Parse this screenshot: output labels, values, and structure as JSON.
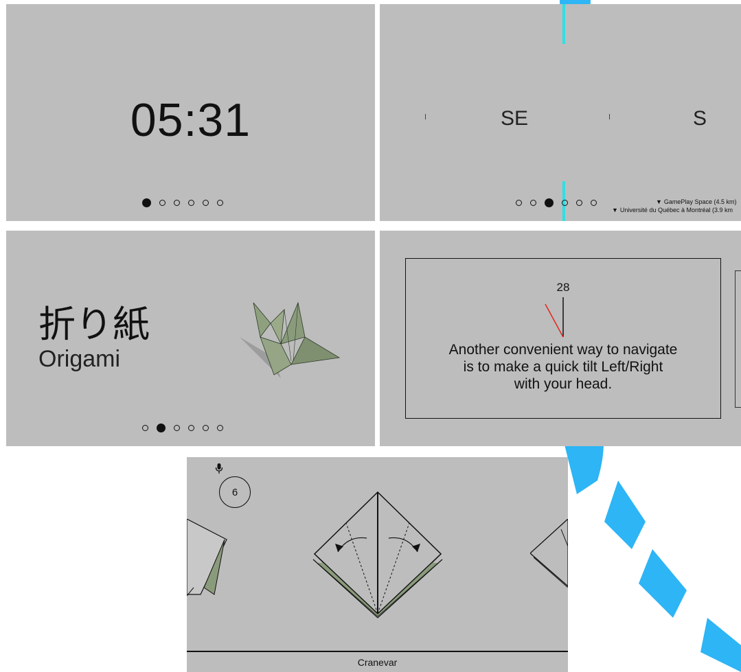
{
  "clock_panel": {
    "time": "05:31",
    "page_index": 0,
    "page_count": 6
  },
  "compass_panel": {
    "headings": [
      "SE",
      "S"
    ],
    "page_index": 2,
    "page_count": 6,
    "pois": [
      {
        "icon": "location-pin-icon",
        "text": "GamePlay Space (4.5 km)"
      },
      {
        "icon": "location-pin-icon",
        "text": "Université du Québec à Montréal (3.9 km"
      }
    ],
    "accent_color": "#2de0e6"
  },
  "origami_panel": {
    "title_jp": "折り紙",
    "title_en": "Origami",
    "page_index": 1,
    "page_count": 6
  },
  "tutorial_panel": {
    "tilt_degrees": "28",
    "text_lines": [
      "Another convenient way to navigate",
      "is to make a quick tilt Left/Right",
      "with your head."
    ]
  },
  "instruction_panel": {
    "step_number": "6",
    "footer_label": "Cranevar"
  }
}
